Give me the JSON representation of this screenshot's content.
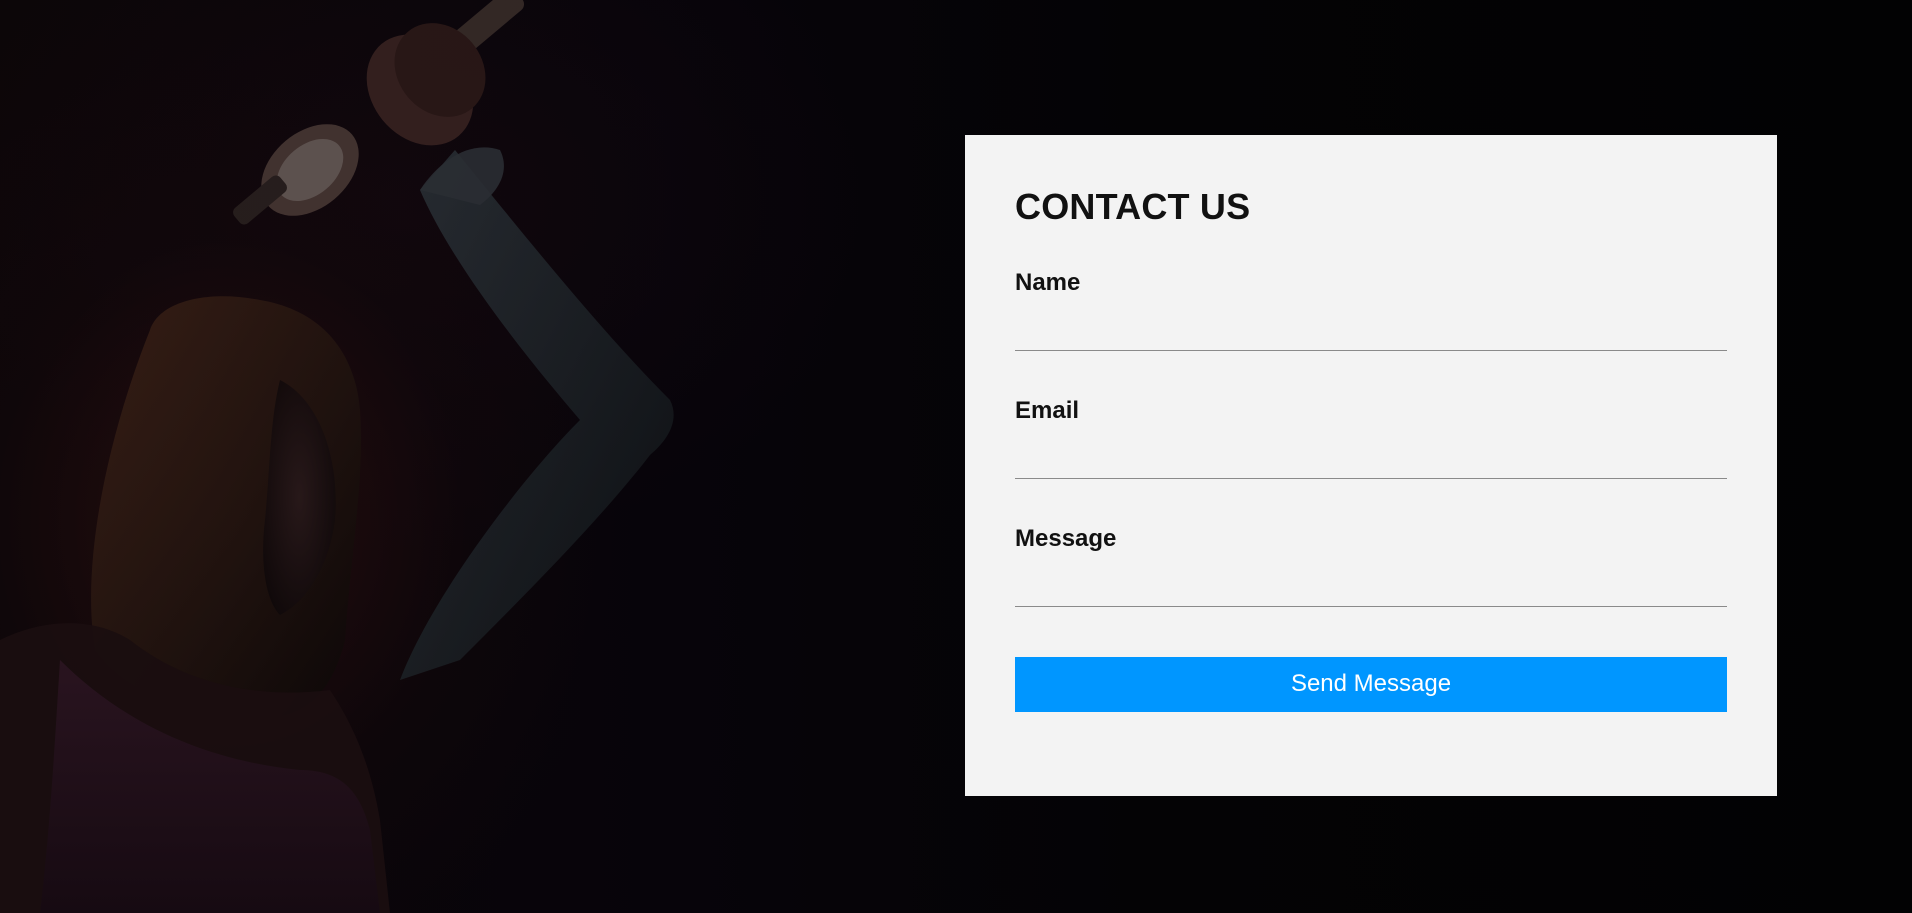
{
  "contact": {
    "title": "CONTACT US",
    "fields": [
      {
        "label": "Name",
        "value": "",
        "placeholder": ""
      },
      {
        "label": "Email",
        "value": "",
        "placeholder": ""
      },
      {
        "label": "Message",
        "value": "",
        "placeholder": ""
      }
    ],
    "submit_label": "Send Message"
  },
  "colors": {
    "background": "#050306",
    "card": "#f3f3f3",
    "accent": "#0096ff"
  },
  "icons": {
    "background_image": "woman-lifting-dumbbell-image"
  }
}
